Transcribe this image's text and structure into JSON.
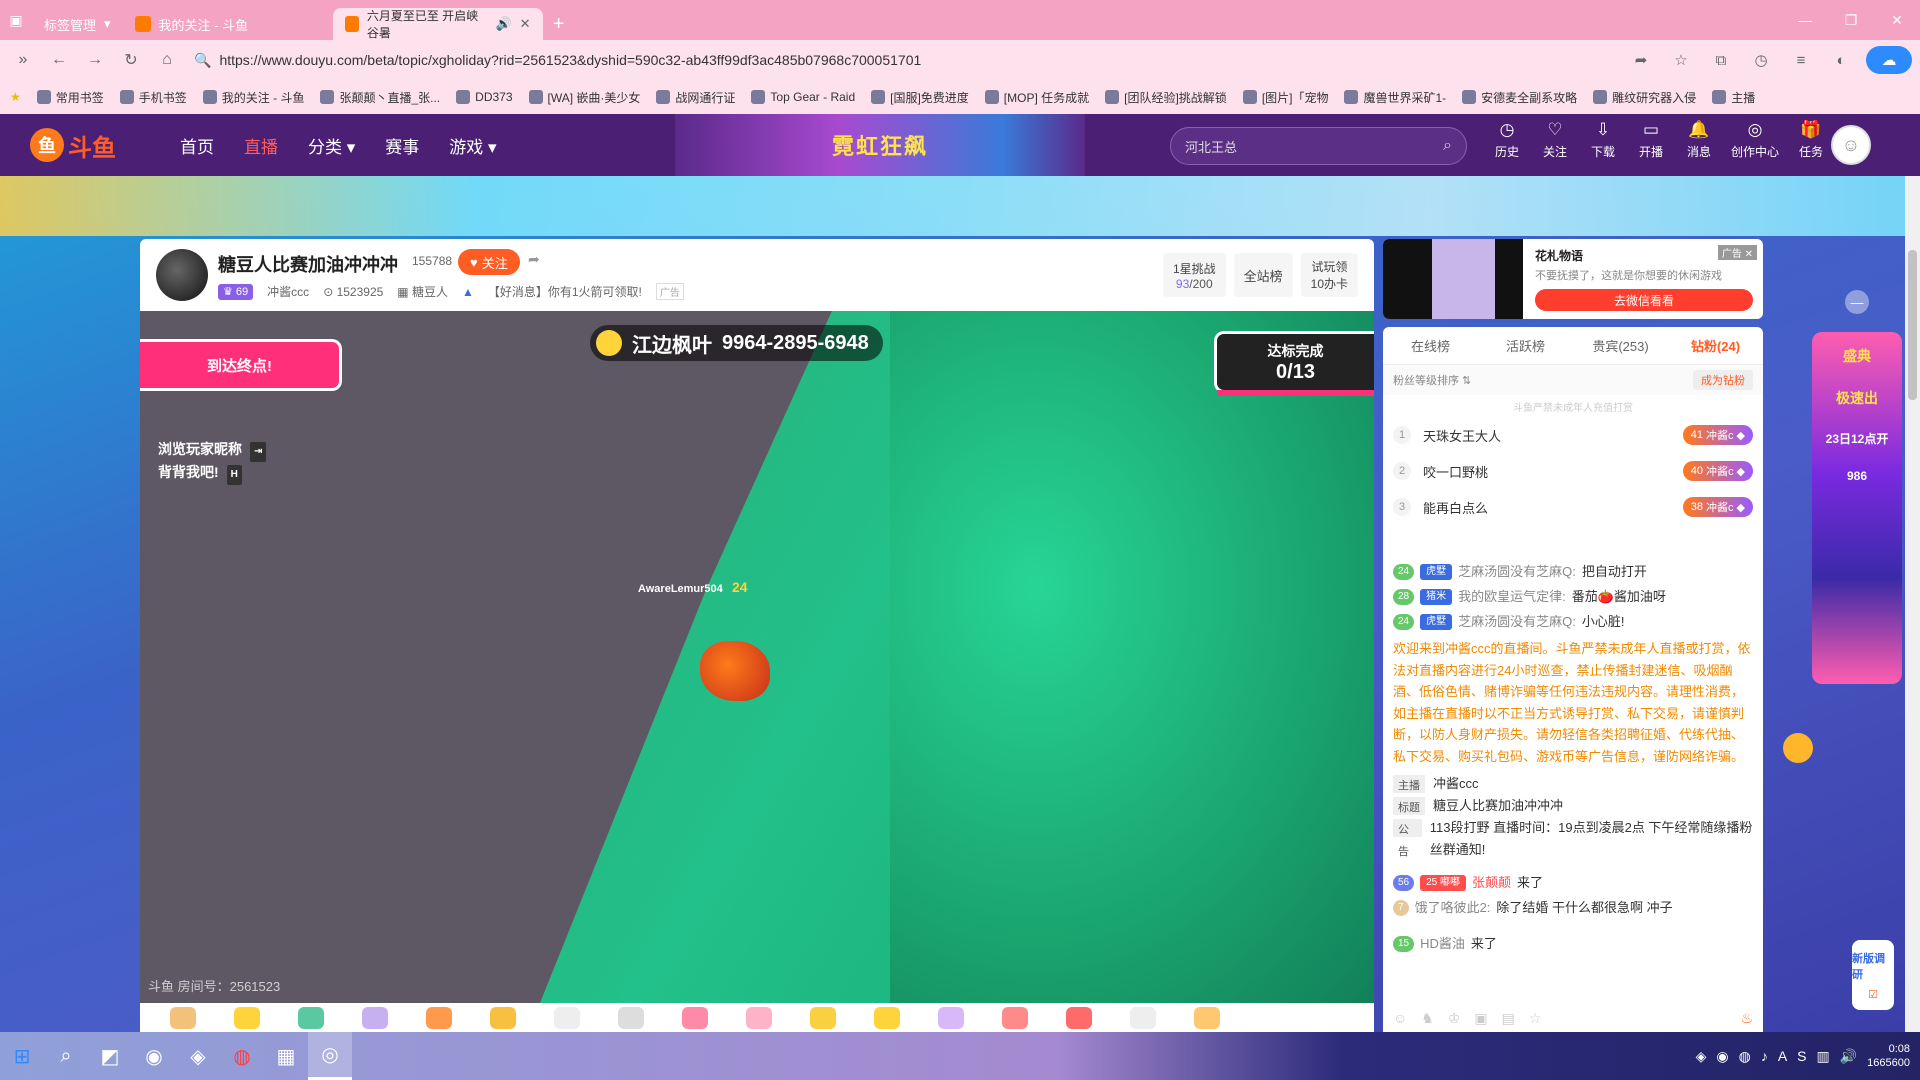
{
  "browser": {
    "tabs": [
      {
        "label": "标签管理"
      },
      {
        "label": "我的关注 - 斗鱼"
      },
      {
        "label": "六月夏至已至 开启峡谷暑",
        "active": true
      }
    ],
    "url": "https://www.douyu.com/beta/topic/xgholiday?rid=2561523&dyshid=590c32-ab43ff99df3ac485b07968c700051701",
    "bookmarks": [
      "常用书签",
      "手机书签",
      "我的关注 - 斗鱼",
      "张颠颠丶直播_张...",
      "DD373",
      "[WA] 嵌曲·美少女",
      "战网通行证",
      "Top Gear - Raid",
      "[国服]免费进度",
      "[MOP] 任务成就",
      "[团队经验]挑战解锁",
      "[图片]「宠物",
      "魔兽世界采矿1-",
      "安德麦全副系攻略",
      "雕纹研究器入侵",
      "主播"
    ]
  },
  "site": {
    "logo": "斗鱼",
    "nav": [
      "首页",
      "直播",
      "分类",
      "赛事",
      "游戏"
    ],
    "nav_active": 1,
    "promo": "霓虹狂飙",
    "search_placeholder": "河北王总",
    "tools": [
      {
        "icon": "history-icon",
        "label": "历史",
        "glyph": "◷"
      },
      {
        "icon": "heart-icon",
        "label": "关注",
        "glyph": "♡"
      },
      {
        "icon": "download-icon",
        "label": "下载",
        "glyph": "⇩"
      },
      {
        "icon": "broadcast-icon",
        "label": "开播",
        "glyph": "▭"
      },
      {
        "icon": "bell-icon",
        "label": "消息",
        "glyph": "🔔"
      },
      {
        "icon": "creator-icon",
        "label": "创作中心",
        "glyph": "◎"
      },
      {
        "icon": "gift-icon",
        "label": "任务",
        "glyph": "🎁"
      }
    ]
  },
  "room": {
    "title": "糖豆人比赛加油冲冲冲",
    "hot": "155788",
    "follow_label": "关注",
    "level": "69",
    "streamer": "冲酱ccc",
    "followers": "1523925",
    "category": "糖豆人",
    "message": "【好消息】你有1火箭可领取!",
    "ad_tag": "广告",
    "challenge_label": "1星挑战",
    "challenge_progress": "93",
    "challenge_total": "/200",
    "rank_label": "全站榜",
    "trial_label": "试玩领",
    "trial_value": "10办卡",
    "room_id": "斗鱼 房间号：2561523"
  },
  "video": {
    "goal": "到达终点!",
    "hint_1": "浏览玩家昵称",
    "hint_1_key": "⇥",
    "hint_2": "背背我吧!",
    "hint_2_key": "H",
    "gamer_name": "江边枫叶",
    "gamer_code": "9964-2895-6948",
    "progress_label": "达标完成",
    "progress_value": "0/13",
    "player_name": "AwareLemur504",
    "player_num": "24"
  },
  "ad": {
    "name": "花札物语",
    "desc": "不要抚摸了，这就是你想要的休闲游戏",
    "cta": "去微信看看",
    "label": "广告"
  },
  "ranking": {
    "tabs": [
      "在线榜",
      "活跃榜",
      "贵宾(253)",
      "钻粉(24)"
    ],
    "active": 3,
    "sort_label": "粉丝等级排序 ⇅",
    "join_label": "成为钻粉",
    "note": "斗鱼严禁未成年人充值打赏",
    "rows": [
      {
        "rank": "1",
        "name": "天珠女王大人",
        "lvl": "41",
        "badge": "冲酱c"
      },
      {
        "rank": "2",
        "name": "咬一口野桃",
        "lvl": "40",
        "badge": "冲酱c"
      },
      {
        "rank": "3",
        "name": "能再白点么",
        "lvl": "38",
        "badge": "冲酱c"
      }
    ]
  },
  "chat": {
    "messages": [
      {
        "lvl": "24",
        "fan": "虎墅",
        "user": "芝麻汤圆没有芝麻Q:",
        "text": "把自动打开"
      },
      {
        "lvl": "28",
        "fan": "猪米",
        "user": "我的欧皇运气定律:",
        "text": "番茄🍅酱加油呀"
      },
      {
        "lvl": "24",
        "fan": "虎墅",
        "user": "芝麻汤圆没有芝麻Q:",
        "text": "小心脏!"
      }
    ],
    "notice": "欢迎来到冲酱ccc的直播间。斗鱼严禁未成年人直播或打赏，依法对直播内容进行24小时巡查，禁止传播封建迷信、吸烟酗酒、低俗色情、赌博诈骗等任何违法违规内容。请理性消费，如主播在直播时以不正当方式诱导打赏、私下交易，请谨慎判断，以防人身财产损失。请勿轻信各类招聘征婚、代练代抽、私下交易、购买礼包码、游戏币等广告信息，谨防网络诈骗。",
    "info": [
      {
        "k": "主播",
        "v": "冲酱ccc"
      },
      {
        "k": "标题",
        "v": "糖豆人比赛加油冲冲冲"
      },
      {
        "k": "公告",
        "v": "113段打野 直播时间：19点到凌晨2点 下午经常随缘播粉丝群通知!"
      }
    ],
    "enter_1_lvl": "56",
    "enter_1_fan": "25",
    "enter_1_badge": "嘟嘟",
    "enter_1_user": "张颠颠",
    "enter_1_text": "来了",
    "msg_4_lvl": "7",
    "msg_4_user": "饿了咯彼此2:",
    "msg_4_text": "除了结婚 干什么都很急啊 冲子",
    "enter_2_lvl": "15",
    "enter_2_user": "HD酱油",
    "enter_2_text": "来了"
  },
  "side": {
    "promo_title": "盛典",
    "promo_sub": "极速出",
    "promo_date": "23日12点开",
    "promo_count": "986",
    "survey": "新版调研"
  },
  "taskbar": {
    "time": "0:08",
    "date": "1665600"
  }
}
